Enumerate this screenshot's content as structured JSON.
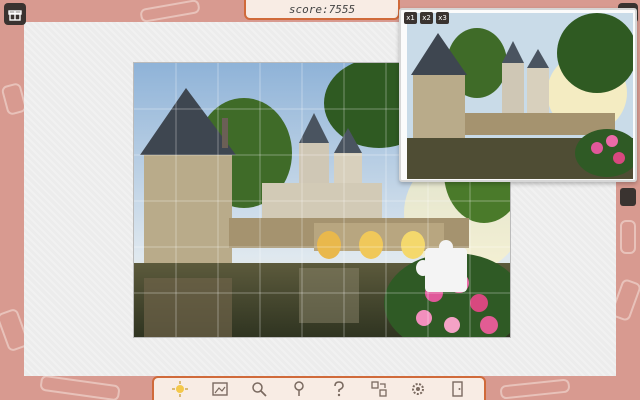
{
  "score": {
    "text": "score:7555"
  },
  "preview": {
    "zoom_buttons": [
      "x1",
      "x2",
      "x3"
    ]
  },
  "icons": {
    "menu": "gift-box-icon",
    "close": "close-icon",
    "tools": [
      "sun-hint-icon",
      "picture-icon",
      "magnifier-icon",
      "pin-icon",
      "question-icon",
      "sort-pieces-icon",
      "settings-gear-icon",
      "exit-icon"
    ]
  },
  "close_label": "✕",
  "colors": {
    "background": "#d89a90",
    "accent": "#d06a3a",
    "panel": "#f8ece4"
  }
}
